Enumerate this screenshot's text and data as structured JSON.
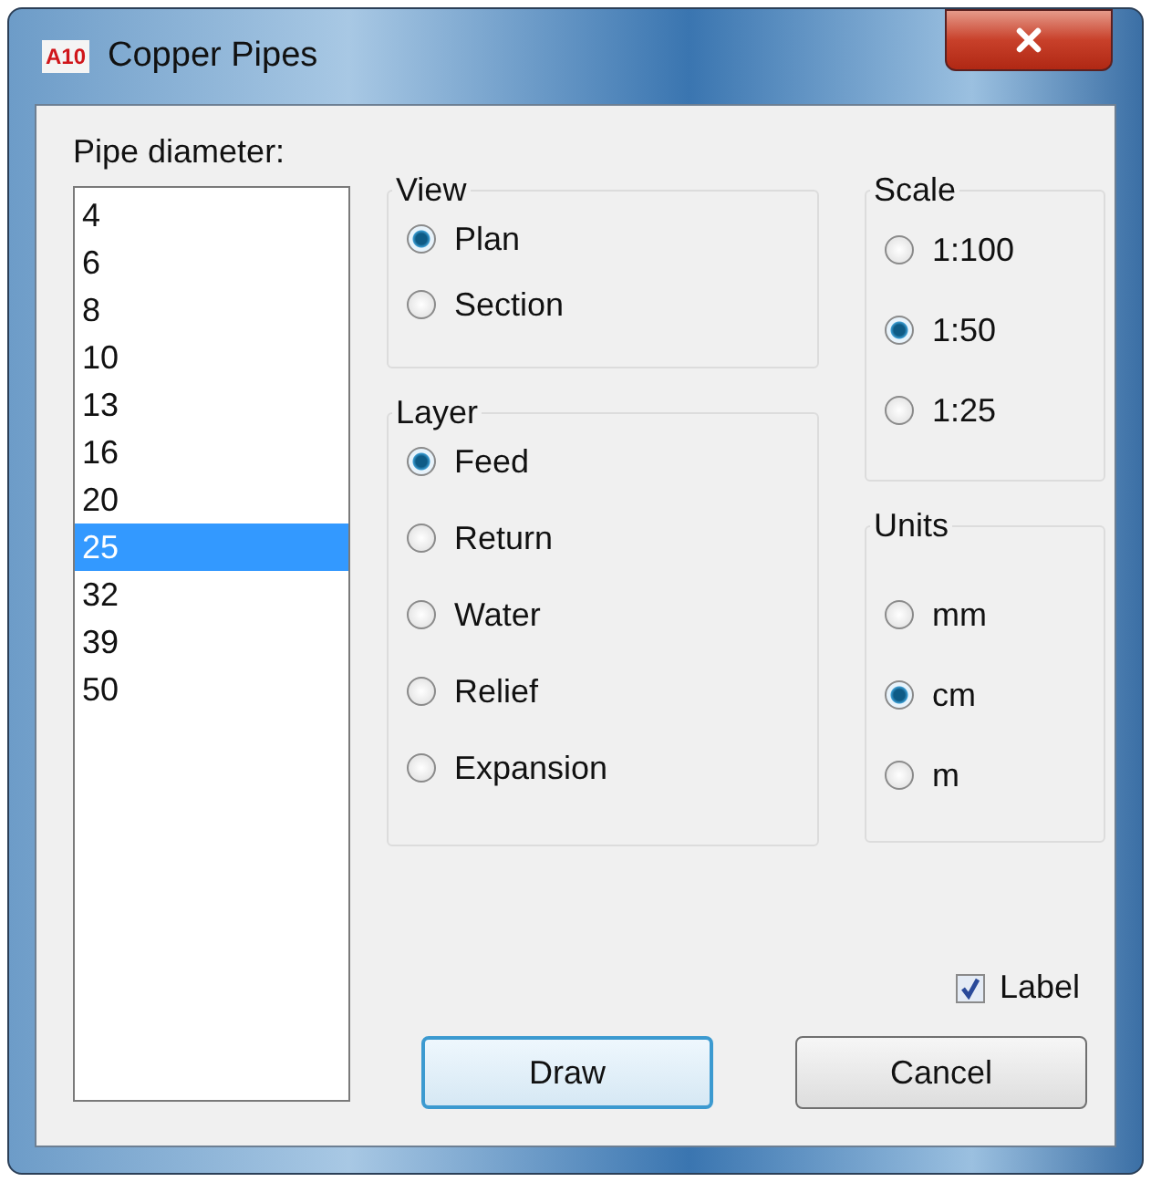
{
  "window": {
    "icon_text": "A10",
    "title": "Copper Pipes"
  },
  "diameter": {
    "label": "Pipe diameter:",
    "items": [
      {
        "text": "4",
        "selected": false
      },
      {
        "text": "6",
        "selected": false
      },
      {
        "text": "8",
        "selected": false
      },
      {
        "text": "10",
        "selected": false
      },
      {
        "text": "13",
        "selected": false
      },
      {
        "text": "16",
        "selected": false
      },
      {
        "text": "20",
        "selected": false
      },
      {
        "text": "25",
        "selected": true
      },
      {
        "text": "32",
        "selected": false
      },
      {
        "text": "39",
        "selected": false
      },
      {
        "text": "50",
        "selected": false
      }
    ]
  },
  "groups": [
    {
      "title": "View",
      "options": [
        {
          "label": "Plan",
          "selected": true
        },
        {
          "label": "Section",
          "selected": false
        }
      ]
    },
    {
      "title": "Layer",
      "options": [
        {
          "label": "Feed",
          "selected": true
        },
        {
          "label": "Return",
          "selected": false
        },
        {
          "label": "Water",
          "selected": false
        },
        {
          "label": "Relief",
          "selected": false
        },
        {
          "label": "Expansion",
          "selected": false
        }
      ]
    },
    {
      "title": "Scale",
      "options": [
        {
          "label": "1:100",
          "selected": false
        },
        {
          "label": "1:50",
          "selected": true
        },
        {
          "label": "1:25",
          "selected": false
        }
      ]
    },
    {
      "title": "Units",
      "options": [
        {
          "label": "mm",
          "selected": false
        },
        {
          "label": "cm",
          "selected": true
        },
        {
          "label": "m",
          "selected": false
        }
      ]
    }
  ],
  "label_checkbox": {
    "label": "Label",
    "checked": true
  },
  "buttons": [
    {
      "label": "Draw",
      "default": true
    },
    {
      "label": "Cancel",
      "default": false
    }
  ]
}
